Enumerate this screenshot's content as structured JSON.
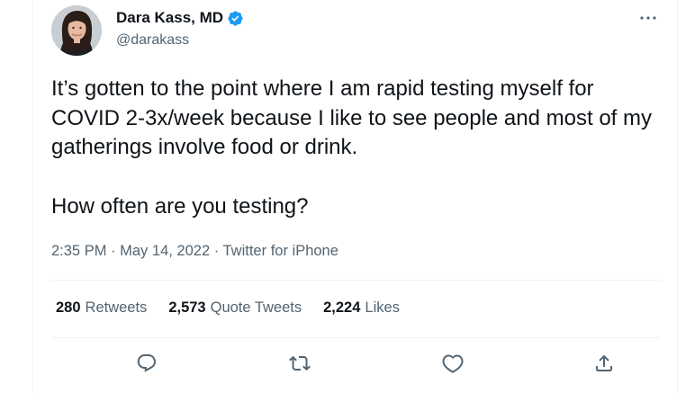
{
  "author": {
    "display_name": "Dara Kass, MD",
    "handle": "@darakass",
    "verified": true
  },
  "tweet": {
    "paragraphs": [
      "It’s gotten to the point where I am rapid testing myself for COVID 2-3x/week because I like to see people and most of my gatherings involve food or drink.",
      "How often are you testing?"
    ]
  },
  "meta": {
    "time": "2:35 PM",
    "sep1": "·",
    "date": "May 14, 2022",
    "sep2": "·",
    "source": "Twitter for iPhone"
  },
  "stats": {
    "retweets_count": "280",
    "retweets_label": "Retweets",
    "quote_count": "2,573",
    "quote_label": "Quote Tweets",
    "likes_count": "2,224",
    "likes_label": "Likes"
  },
  "colors": {
    "text": "#0f1419",
    "secondary": "#536471",
    "verified": "#1d9bf0",
    "divider": "#eff3f4"
  },
  "icons": {
    "more": "more-horizontal-icon",
    "reply": "reply-icon",
    "retweet": "retweet-icon",
    "like": "heart-icon",
    "share": "share-icon",
    "verified": "verified-badge-icon"
  }
}
